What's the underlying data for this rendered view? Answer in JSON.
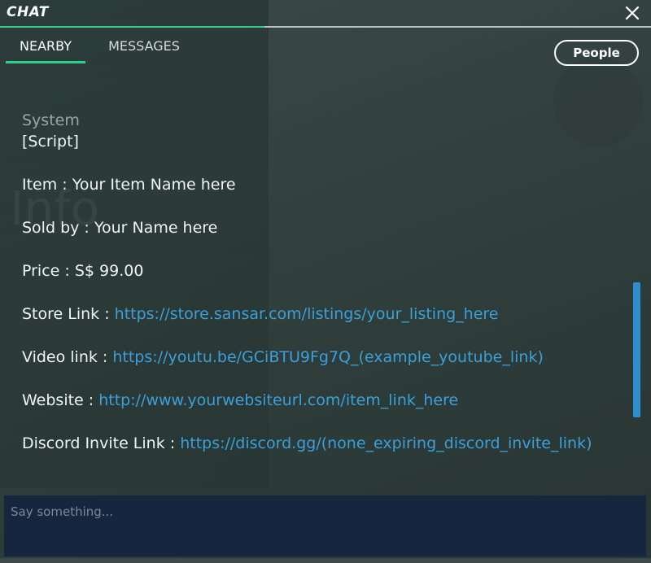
{
  "window": {
    "title": "CHAT"
  },
  "tabs": [
    {
      "label": "NEARBY",
      "active": true
    },
    {
      "label": "MESSAGES",
      "active": false
    }
  ],
  "people_button": "People",
  "background_text": "r Info",
  "message": {
    "sender": "System",
    "lines": [
      {
        "label": "[Script]",
        "value": ""
      },
      {
        "label": "Item : ",
        "value": "Your Item Name here"
      },
      {
        "label": "Sold by : ",
        "value": "Your Name here"
      },
      {
        "label": "Price : ",
        "value": "S$ 99.00"
      },
      {
        "label": "Store Link : ",
        "link": "https://store.sansar.com/listings/your_listing_here"
      },
      {
        "label": "Video link : ",
        "link": "https://youtu.be/GCiBTU9Fg7Q_(example_youtube_link)"
      },
      {
        "label": "Website : ",
        "link": "http://www.yourwebsiteurl.com/item_link_here"
      },
      {
        "label": "Discord Invite Link : ",
        "link": "https://discord.gg/(none_expiring_discord_invite_link)"
      }
    ]
  },
  "input": {
    "placeholder": "Say something..."
  },
  "colors": {
    "accent": "#2ed08a",
    "link": "#3aa0da",
    "scrollbar": "#2e8fd0",
    "input_bg": "#15263e"
  },
  "icons": {
    "close": "close-icon"
  }
}
